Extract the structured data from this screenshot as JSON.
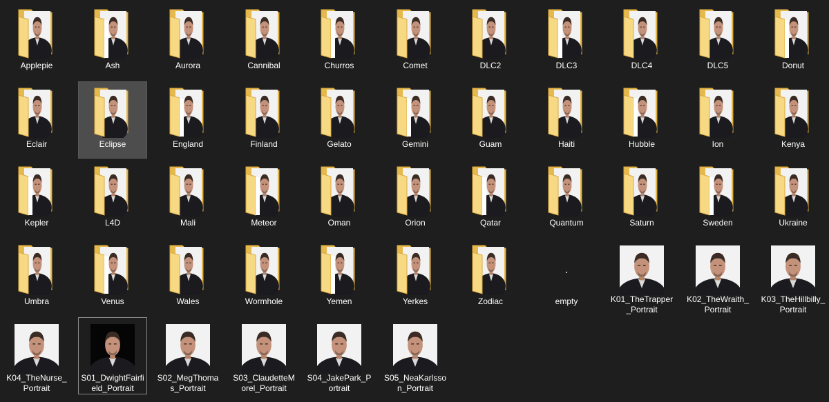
{
  "colors": {
    "background": "#1e1e1e",
    "folder_back": "#e6b94d",
    "folder_front": "#f7d983",
    "folder_edge": "#d9a940",
    "selection": "#4d4d4d",
    "text": "#ffffff"
  },
  "items": [
    {
      "type": "folder",
      "label": "Applepie",
      "icon": "folder-with-portrait-icon"
    },
    {
      "type": "folder",
      "label": "Ash",
      "icon": "folder-with-portrait-icon"
    },
    {
      "type": "folder",
      "label": "Aurora",
      "icon": "folder-with-portrait-icon"
    },
    {
      "type": "folder",
      "label": "Cannibal",
      "icon": "folder-with-portrait-icon"
    },
    {
      "type": "folder",
      "label": "Churros",
      "icon": "folder-with-portrait-icon"
    },
    {
      "type": "folder",
      "label": "Comet",
      "icon": "folder-with-portrait-icon"
    },
    {
      "type": "folder",
      "label": "DLC2",
      "icon": "folder-with-portrait-icon"
    },
    {
      "type": "folder",
      "label": "DLC3",
      "icon": "folder-with-portrait-icon"
    },
    {
      "type": "folder",
      "label": "DLC4",
      "icon": "folder-with-portrait-icon"
    },
    {
      "type": "folder",
      "label": "DLC5",
      "icon": "folder-with-portrait-icon"
    },
    {
      "type": "folder",
      "label": "Donut",
      "icon": "folder-with-portrait-icon"
    },
    {
      "type": "folder",
      "label": "Eclair",
      "icon": "folder-with-portrait-icon"
    },
    {
      "type": "folder",
      "label": "Eclipse",
      "icon": "folder-with-portrait-icon",
      "selected": true
    },
    {
      "type": "folder",
      "label": "England",
      "icon": "folder-with-portrait-icon"
    },
    {
      "type": "folder",
      "label": "Finland",
      "icon": "folder-with-portrait-icon"
    },
    {
      "type": "folder",
      "label": "Gelato",
      "icon": "folder-with-portrait-icon"
    },
    {
      "type": "folder",
      "label": "Gemini",
      "icon": "folder-with-portrait-icon"
    },
    {
      "type": "folder",
      "label": "Guam",
      "icon": "folder-with-portrait-icon"
    },
    {
      "type": "folder",
      "label": "Haiti",
      "icon": "folder-with-portrait-icon"
    },
    {
      "type": "folder",
      "label": "Hubble",
      "icon": "folder-with-portrait-icon"
    },
    {
      "type": "folder",
      "label": "Ion",
      "icon": "folder-with-portrait-icon"
    },
    {
      "type": "folder",
      "label": "Kenya",
      "icon": "folder-with-portrait-icon"
    },
    {
      "type": "folder",
      "label": "Kepler",
      "icon": "folder-with-portrait-icon"
    },
    {
      "type": "folder",
      "label": "L4D",
      "icon": "folder-with-portrait-icon"
    },
    {
      "type": "folder",
      "label": "Mali",
      "icon": "folder-with-portrait-icon"
    },
    {
      "type": "folder",
      "label": "Meteor",
      "icon": "folder-with-portrait-icon"
    },
    {
      "type": "folder",
      "label": "Oman",
      "icon": "folder-with-portrait-icon"
    },
    {
      "type": "folder",
      "label": "Orion",
      "icon": "folder-with-portrait-icon"
    },
    {
      "type": "folder",
      "label": "Qatar",
      "icon": "folder-with-portrait-icon"
    },
    {
      "type": "folder",
      "label": "Quantum",
      "icon": "folder-with-portrait-icon"
    },
    {
      "type": "folder",
      "label": "Saturn",
      "icon": "folder-with-portrait-icon"
    },
    {
      "type": "folder",
      "label": "Sweden",
      "icon": "folder-with-portrait-icon"
    },
    {
      "type": "folder",
      "label": "Ukraine",
      "icon": "folder-with-portrait-icon"
    },
    {
      "type": "folder",
      "label": "Umbra",
      "icon": "folder-with-portrait-icon"
    },
    {
      "type": "folder",
      "label": "Venus",
      "icon": "folder-with-portrait-icon"
    },
    {
      "type": "folder",
      "label": "Wales",
      "icon": "folder-with-portrait-icon"
    },
    {
      "type": "folder",
      "label": "Wormhole",
      "icon": "folder-with-portrait-icon"
    },
    {
      "type": "folder",
      "label": "Yemen",
      "icon": "folder-with-portrait-icon"
    },
    {
      "type": "folder",
      "label": "Yerkes",
      "icon": "folder-with-portrait-icon"
    },
    {
      "type": "folder",
      "label": "Zodiac",
      "icon": "folder-with-portrait-icon"
    },
    {
      "type": "empty",
      "label": "empty",
      "icon": "empty-image-icon"
    },
    {
      "type": "image",
      "label": "K01_TheTrapper_Portrait",
      "icon": "portrait-image-icon"
    },
    {
      "type": "image",
      "label": "K02_TheWraith_Portrait",
      "icon": "portrait-image-icon"
    },
    {
      "type": "image",
      "label": "K03_TheHillbilly_Portrait",
      "icon": "portrait-image-icon"
    },
    {
      "type": "image",
      "label": "K04_TheNurse_Portrait",
      "icon": "portrait-image-icon"
    },
    {
      "type": "image",
      "label": "S01_DwightFairfield_Portrait",
      "icon": "portrait-image-icon",
      "focused": true,
      "dark": true
    },
    {
      "type": "image",
      "label": "S02_MegThomas_Portrait",
      "icon": "portrait-image-icon"
    },
    {
      "type": "image",
      "label": "S03_ClaudetteMorel_Portrait",
      "icon": "portrait-image-icon"
    },
    {
      "type": "image",
      "label": "S04_JakePark_Portrait",
      "icon": "portrait-image-icon"
    },
    {
      "type": "image",
      "label": "S05_NeaKarlsson_Portrait",
      "icon": "portrait-image-icon"
    }
  ]
}
